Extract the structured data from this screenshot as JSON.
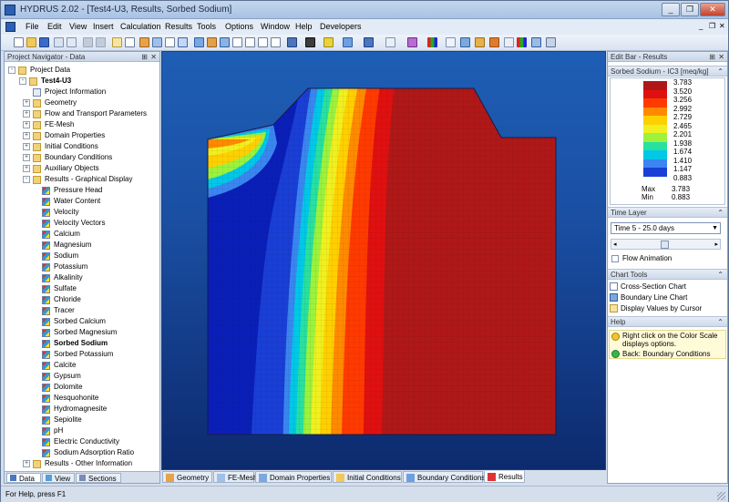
{
  "window": {
    "title": "HYDRUS 2.02 - [Test4-U3, Results, Sorbed Sodium]",
    "minimize": "_",
    "restore": "❐",
    "close": "✕"
  },
  "menu": [
    "File",
    "Edit",
    "View",
    "Insert",
    "Calculation",
    "Results",
    "Tools",
    "Options",
    "Window",
    "Help",
    "Developers"
  ],
  "navigator": {
    "title": "Project Navigator - Data",
    "pin": "⊞",
    "close": "✕",
    "items": [
      {
        "label": "Project Data",
        "level": 0,
        "icon": "folder",
        "expander": "-"
      },
      {
        "label": "Test4-U3",
        "level": 1,
        "icon": "folder",
        "expander": "-",
        "bold": true
      },
      {
        "label": "Project Information",
        "level": 2,
        "icon": "doc",
        "expander": ""
      },
      {
        "label": "Geometry",
        "level": 2,
        "icon": "folder",
        "expander": "+"
      },
      {
        "label": "Flow and Transport Parameters",
        "level": 2,
        "icon": "folder",
        "expander": "+"
      },
      {
        "label": "FE-Mesh",
        "level": 2,
        "icon": "folder",
        "expander": "+"
      },
      {
        "label": "Domain Properties",
        "level": 2,
        "icon": "folder",
        "expander": "+"
      },
      {
        "label": "Initial Conditions",
        "level": 2,
        "icon": "folder",
        "expander": "+"
      },
      {
        "label": "Boundary Conditions",
        "level": 2,
        "icon": "folder",
        "expander": "+"
      },
      {
        "label": "Auxiliary Objects",
        "level": 2,
        "icon": "folder",
        "expander": "+"
      },
      {
        "label": "Results - Graphical Display",
        "level": 2,
        "icon": "folder",
        "expander": "-"
      },
      {
        "label": "Pressure Head",
        "level": 3,
        "icon": "res",
        "expander": ""
      },
      {
        "label": "Water Content",
        "level": 3,
        "icon": "res",
        "expander": ""
      },
      {
        "label": "Velocity",
        "level": 3,
        "icon": "res",
        "expander": ""
      },
      {
        "label": "Velocity Vectors",
        "level": 3,
        "icon": "res",
        "expander": ""
      },
      {
        "label": "Calcium",
        "level": 3,
        "icon": "res",
        "expander": ""
      },
      {
        "label": "Magnesium",
        "level": 3,
        "icon": "res",
        "expander": ""
      },
      {
        "label": "Sodium",
        "level": 3,
        "icon": "res",
        "expander": ""
      },
      {
        "label": "Potassium",
        "level": 3,
        "icon": "res",
        "expander": ""
      },
      {
        "label": "Alkalinity",
        "level": 3,
        "icon": "res",
        "expander": ""
      },
      {
        "label": "Sulfate",
        "level": 3,
        "icon": "res",
        "expander": ""
      },
      {
        "label": "Chloride",
        "level": 3,
        "icon": "res",
        "expander": ""
      },
      {
        "label": "Tracer",
        "level": 3,
        "icon": "res",
        "expander": ""
      },
      {
        "label": "Sorbed Calcium",
        "level": 3,
        "icon": "res",
        "expander": ""
      },
      {
        "label": "Sorbed Magnesium",
        "level": 3,
        "icon": "res",
        "expander": ""
      },
      {
        "label": "Sorbed Sodium",
        "level": 3,
        "icon": "res",
        "expander": "",
        "bold": true
      },
      {
        "label": "Sorbed Potassium",
        "level": 3,
        "icon": "res",
        "expander": ""
      },
      {
        "label": "Calcite",
        "level": 3,
        "icon": "res",
        "expander": ""
      },
      {
        "label": "Gypsum",
        "level": 3,
        "icon": "res",
        "expander": ""
      },
      {
        "label": "Dolomite",
        "level": 3,
        "icon": "res",
        "expander": ""
      },
      {
        "label": "Nesquohonite",
        "level": 3,
        "icon": "res",
        "expander": ""
      },
      {
        "label": "Hydromagnesite",
        "level": 3,
        "icon": "res",
        "expander": ""
      },
      {
        "label": "Sepiolite",
        "level": 3,
        "icon": "res",
        "expander": ""
      },
      {
        "label": "pH",
        "level": 3,
        "icon": "res",
        "expander": ""
      },
      {
        "label": "Electric Conductivity",
        "level": 3,
        "icon": "res",
        "expander": ""
      },
      {
        "label": "Sodium Adsorption Ratio",
        "level": 3,
        "icon": "res",
        "expander": ""
      },
      {
        "label": "Results - Other Information",
        "level": 2,
        "icon": "folder",
        "expander": "+"
      }
    ],
    "tabs": [
      "Data",
      "View",
      "Sections"
    ]
  },
  "view_tabs": [
    "Geometry",
    "FE-Mesh",
    "Domain Properties",
    "Initial Conditions",
    "Boundary Conditions",
    "Results"
  ],
  "edit_bar": {
    "title": "Edit Bar - Results",
    "pin": "⊞",
    "close": "✕",
    "scale_title": "Sorbed Sodium - IC3 [meq/kg]",
    "scale_values": [
      "3.783",
      "3.520",
      "3.256",
      "2.992",
      "2.729",
      "2.465",
      "2.201",
      "1.938",
      "1.674",
      "1.410",
      "1.147",
      "0.883"
    ],
    "scale_colors": [
      "#b01818",
      "#e01010",
      "#ff3a00",
      "#ff8a00",
      "#ffd000",
      "#f0f020",
      "#9cf23c",
      "#28e0a0",
      "#00c8e6",
      "#3a86f0",
      "#1a3fd6",
      "#0a1fb8"
    ],
    "max_label": "Max",
    "max_value": "3.783",
    "min_label": "Min",
    "min_value": "0.883",
    "time_layer_title": "Time Layer",
    "time_layer_value": "Time 5 - 25.0 days",
    "slider_position": 0.45,
    "flow_animation_label": "Flow Animation",
    "chart_tools_title": "Chart Tools",
    "chart_tools": [
      "Cross-Section Chart",
      "Boundary Line Chart",
      "Display Values by Cursor"
    ],
    "help_title": "Help",
    "help_lines": [
      "Right click on the Color Scale",
      "displays options."
    ],
    "help_back": "Back: Boundary Conditions"
  },
  "status": "For Help, press F1"
}
